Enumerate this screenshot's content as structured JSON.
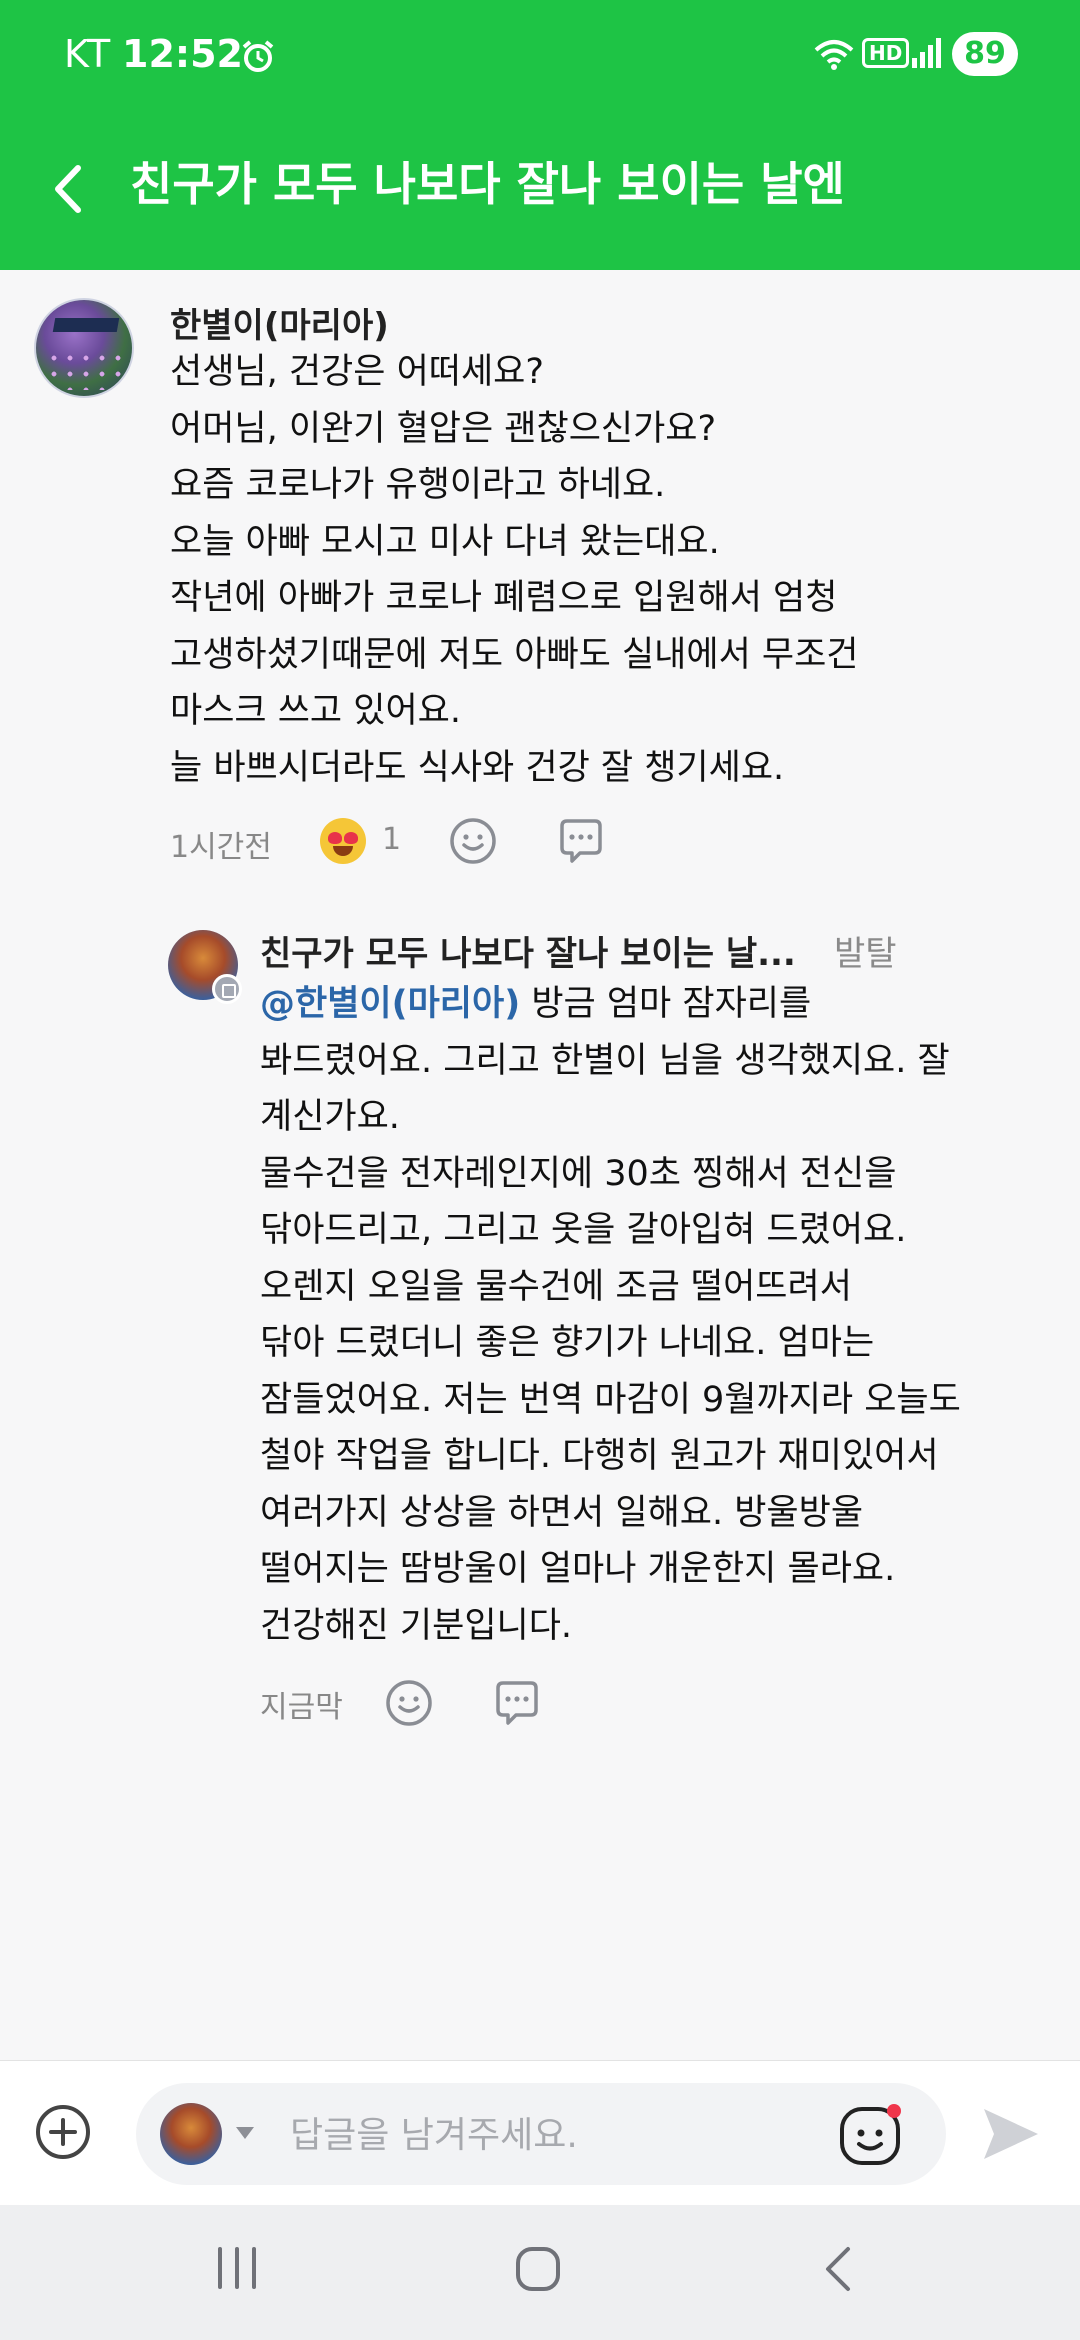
{
  "status_bar": {
    "carrier": "KT",
    "time": "12:52",
    "hd_label": "HD",
    "battery": "89"
  },
  "header": {
    "title": "친구가 모두 나보다 잘나 보이는 날엔"
  },
  "comments": [
    {
      "author": "한별이(마리아)",
      "lines": [
        "선생님, 건강은 어떠세요?",
        "어머님, 이완기 혈압은 괜찮으신가요?",
        "요즘 코로나가 유행이라고 하네요.",
        "오늘 아빠 모시고 미사 다녀 왔는대요.",
        "작년에 아빠가 코로나 폐렴으로 입원해서 엄청",
        "고생하셨기때문에 저도 아빠도 실내에서 무조건",
        "마스크 쓰고 있어요.",
        "늘 바쁘시더라도 식사와 건강 잘 챙기세요."
      ],
      "time": "1시간전",
      "reaction_count": "1"
    }
  ],
  "reply": {
    "author": "친구가 모두 나보다 잘나 보이는 날...",
    "tag": "발탈",
    "mention": "@한별이(마리아)",
    "first_line_rest": " 방금 엄마 잠자리를",
    "lines": [
      "봐드렸어요. 그리고 한별이 님을 생각했지요. 잘",
      "계신가요.",
      "물수건을 전자레인지에 30초 찡해서 전신을",
      "닦아드리고, 그리고 옷을 갈아입혀 드렸어요.",
      "오렌지 오일을 물수건에 조금 떨어뜨려서",
      "닦아 드렸더니 좋은 향기가 나네요. 엄마는",
      "잠들었어요. 저는 번역 마감이 9월까지라 오늘도",
      "철야 작업을 합니다. 다행히 원고가 재미있어서",
      "여러가지 상상을 하면서 일해요. 방울방울",
      "떨어지는 땀방울이 얼마나 개운한지 몰라요.",
      "건강해진 기분입니다."
    ],
    "time": "지금막"
  },
  "input": {
    "placeholder": "답글을 남겨주세요."
  },
  "colors": {
    "brand_green": "#1ec445",
    "mention_blue": "#2b66a8"
  }
}
